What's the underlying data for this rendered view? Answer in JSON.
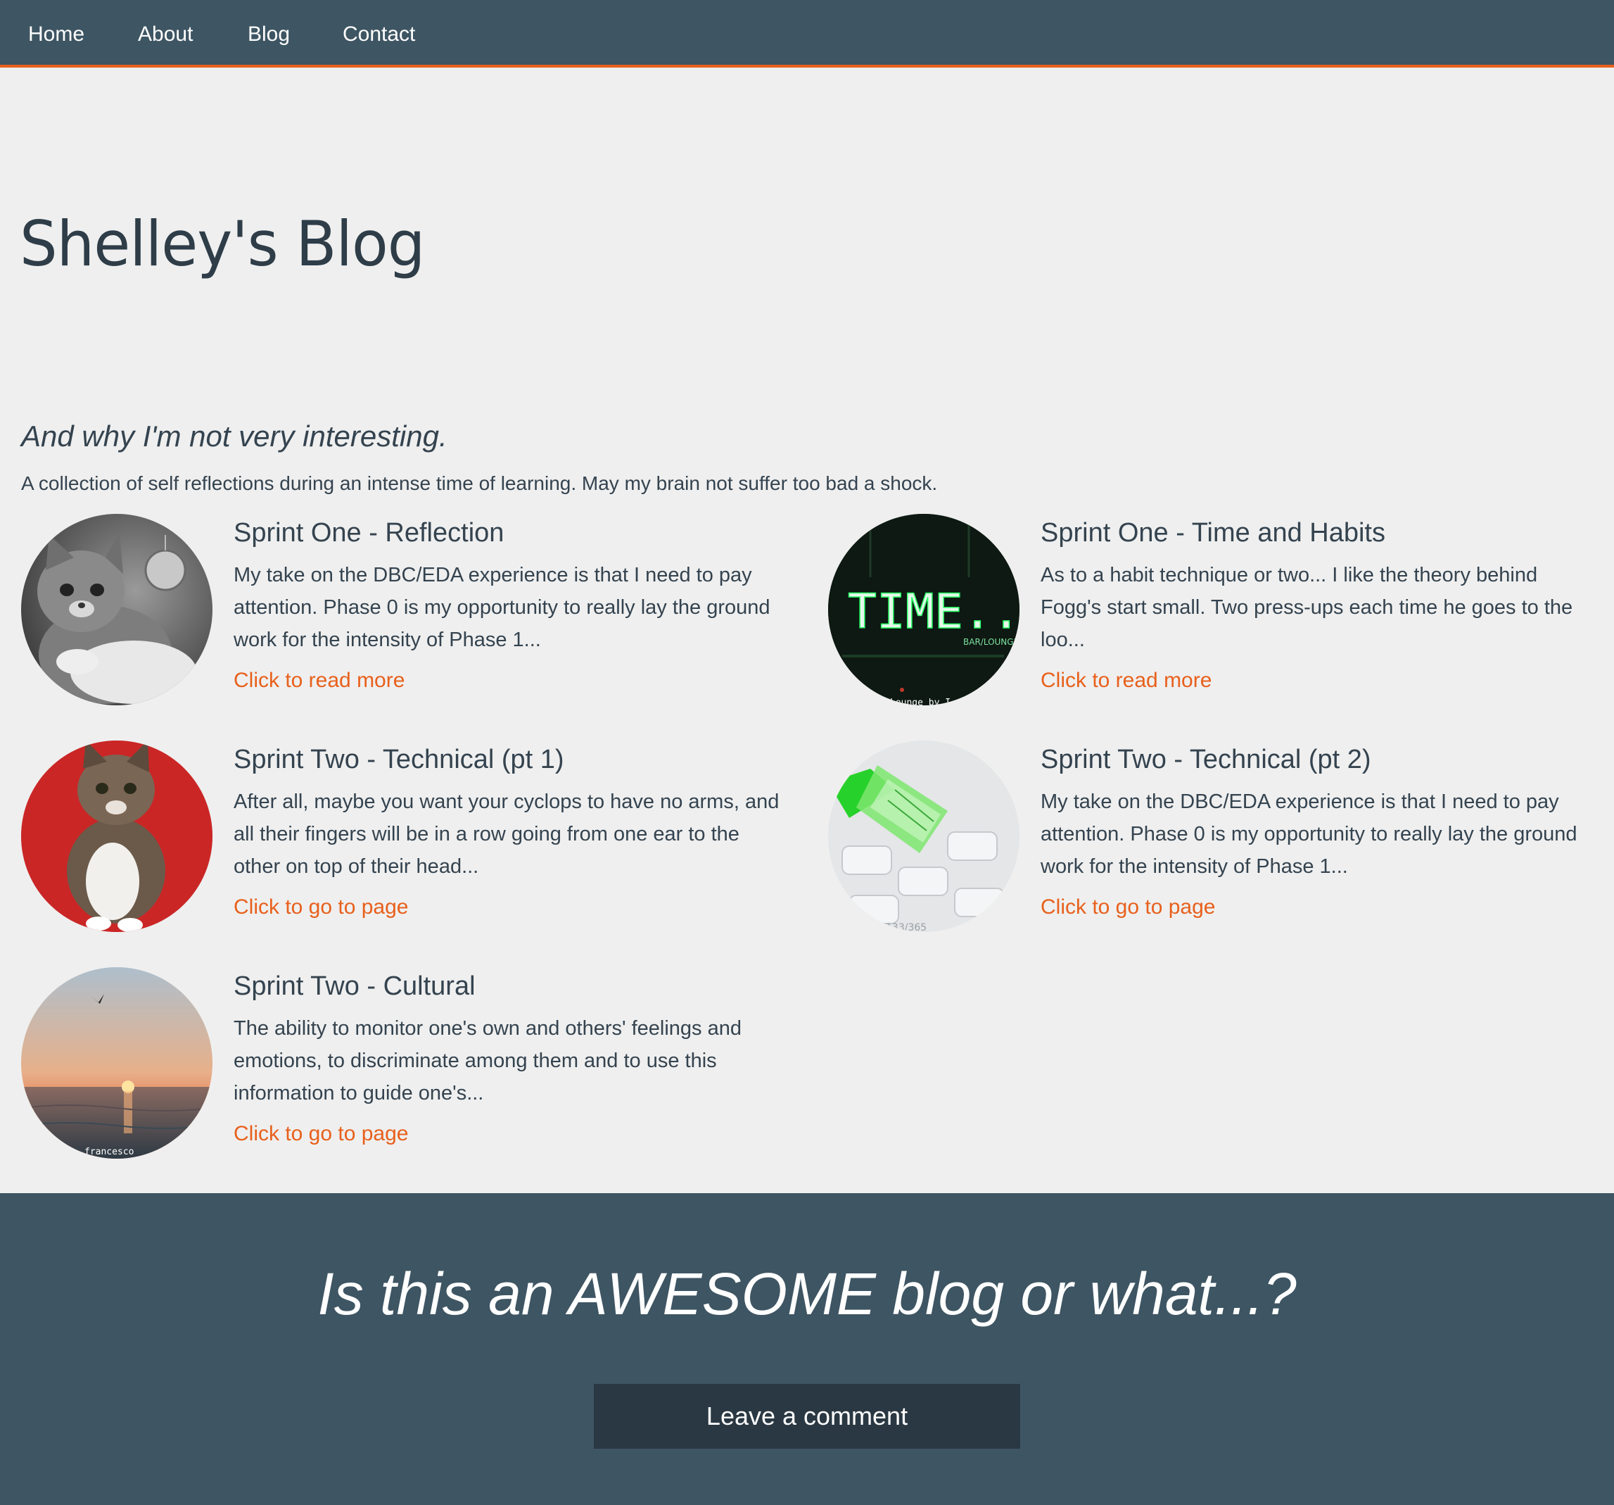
{
  "nav": {
    "items": [
      {
        "label": "Home"
      },
      {
        "label": "About"
      },
      {
        "label": "Blog"
      },
      {
        "label": "Contact"
      }
    ]
  },
  "hero": {
    "title": "Shelley's Blog",
    "tagline": "And why I'm not very interesting.",
    "intro": "A collection of self reflections during an intense time of learning. May my brain not suffer too bad a shock."
  },
  "posts": [
    {
      "title": "Sprint One - Reflection",
      "excerpt": "My take on the DBC/EDA experience is that I need to pay attention. Phase 0 is my opportunity to really lay the ground work for the intensity of Phase 1...",
      "link": "Click to read more",
      "thumbnail": "kitten-bw-thumbnail"
    },
    {
      "title": "Sprint One - Time and Habits",
      "excerpt": "As to a habit technique or two... I like the theory behind Fogg's start small. Two press-ups each time he goes to the loo...",
      "link": "Click to read more",
      "thumbnail": "neon-time-sign-thumbnail",
      "thumb_text": "TIME....",
      "thumb_subtext": "BAR/LOUNGE",
      "thumb_caption": "Lounge by I"
    },
    {
      "title": "Sprint Two - Technical (pt 1)",
      "excerpt": "After all, maybe you want your cyclops to have no arms, and all their fingers will be in a row going from one ear to the other on top of their head...",
      "link": "Click to go to page",
      "thumbnail": "kitten-red-background-thumbnail"
    },
    {
      "title": "Sprint Two - Technical (pt 2)",
      "excerpt": "My take on the DBC/EDA experience is that I need to pay attention. Phase 0 is my opportunity to really lay the ground work for the intensity of Phase 1...",
      "link": "Click to go to page",
      "thumbnail": "ethernet-cable-thumbnail",
      "thumb_caption": "133/365"
    },
    {
      "title": "Sprint Two - Cultural",
      "excerpt": "The ability to monitor one's own and others' feelings and emotions, to discriminate among them and to use this information to guide one's...",
      "link": "Click to go to page",
      "thumbnail": "sunset-sea-thumbnail",
      "thumb_caption": "francesco"
    }
  ],
  "footer": {
    "heading": "Is this an AWESOME blog or what...?",
    "button_label": "Leave a comment"
  },
  "colors": {
    "nav_background": "#3e5563",
    "accent": "#e8601c",
    "page_background": "#efefef",
    "text": "#34434f",
    "button_background": "#2a3843"
  }
}
